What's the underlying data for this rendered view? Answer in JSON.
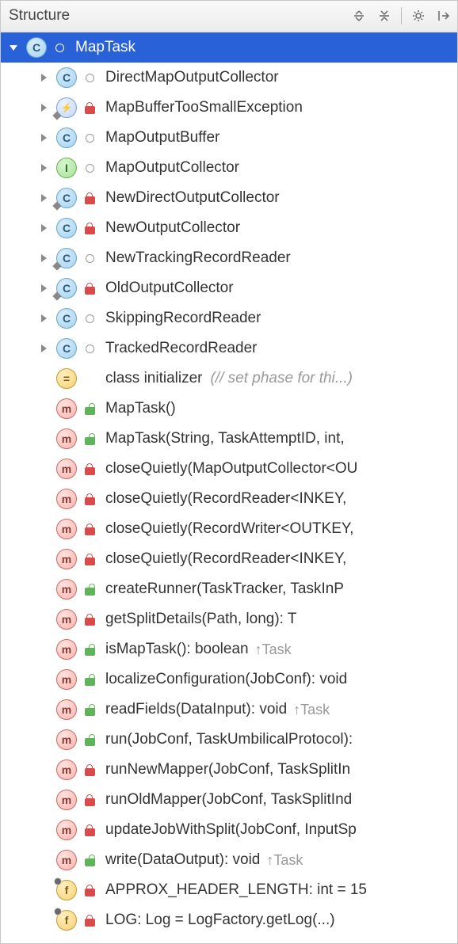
{
  "panel": {
    "title": "Structure"
  },
  "root": {
    "name": "MapTask",
    "kind_letter": "C"
  },
  "children": [
    {
      "expand": true,
      "kind": "class",
      "letter": "C",
      "vis": "circle",
      "label": "DirectMapOutputCollector"
    },
    {
      "expand": true,
      "kind": "exception",
      "letter": "",
      "vis": "red",
      "label": "MapBufferTooSmallException",
      "diamond": true
    },
    {
      "expand": true,
      "kind": "class",
      "letter": "C",
      "vis": "circle",
      "label": "MapOutputBuffer"
    },
    {
      "expand": true,
      "kind": "interface",
      "letter": "I",
      "vis": "circle",
      "label": "MapOutputCollector"
    },
    {
      "expand": true,
      "kind": "class",
      "letter": "C",
      "vis": "red",
      "label": "NewDirectOutputCollector",
      "diamond": true
    },
    {
      "expand": true,
      "kind": "class",
      "letter": "C",
      "vis": "red",
      "label": "NewOutputCollector"
    },
    {
      "expand": true,
      "kind": "class",
      "letter": "C",
      "vis": "circle",
      "label": "NewTrackingRecordReader",
      "diamond": true
    },
    {
      "expand": true,
      "kind": "class",
      "letter": "C",
      "vis": "red",
      "label": "OldOutputCollector",
      "diamond": true
    },
    {
      "expand": true,
      "kind": "class",
      "letter": "C",
      "vis": "circle",
      "label": "SkippingRecordReader"
    },
    {
      "expand": true,
      "kind": "class",
      "letter": "C",
      "vis": "circle",
      "label": "TrackedRecordReader"
    },
    {
      "expand": false,
      "kind": "init",
      "letter": "=",
      "vis": "",
      "label": "class initializer",
      "annot": "(// set phase for thi...)"
    },
    {
      "expand": false,
      "kind": "method",
      "letter": "m",
      "vis": "green",
      "label": "MapTask()"
    },
    {
      "expand": false,
      "kind": "method",
      "letter": "m",
      "vis": "green",
      "label": "MapTask(String, TaskAttemptID, int,"
    },
    {
      "expand": false,
      "kind": "method",
      "letter": "m",
      "vis": "red",
      "label": "closeQuietly(MapOutputCollector<OU"
    },
    {
      "expand": false,
      "kind": "method",
      "letter": "m",
      "vis": "red",
      "label": "closeQuietly(RecordReader<INKEY,"
    },
    {
      "expand": false,
      "kind": "method",
      "letter": "m",
      "vis": "red",
      "label": "closeQuietly(RecordWriter<OUTKEY,"
    },
    {
      "expand": false,
      "kind": "method",
      "letter": "m",
      "vis": "red",
      "label": "closeQuietly(RecordReader<INKEY,"
    },
    {
      "expand": false,
      "kind": "method",
      "letter": "m",
      "vis": "green",
      "label": "createRunner(TaskTracker, TaskInP"
    },
    {
      "expand": false,
      "kind": "method",
      "letter": "m",
      "vis": "red",
      "label": "getSplitDetails(Path, long): T"
    },
    {
      "expand": false,
      "kind": "method",
      "letter": "m",
      "vis": "green",
      "label": "isMapTask(): boolean",
      "inherit": "↑Task"
    },
    {
      "expand": false,
      "kind": "method",
      "letter": "m",
      "vis": "green",
      "label": "localizeConfiguration(JobConf): void"
    },
    {
      "expand": false,
      "kind": "method",
      "letter": "m",
      "vis": "green",
      "label": "readFields(DataInput): void",
      "inherit": "↑Task"
    },
    {
      "expand": false,
      "kind": "method",
      "letter": "m",
      "vis": "green",
      "label": "run(JobConf, TaskUmbilicalProtocol):"
    },
    {
      "expand": false,
      "kind": "method",
      "letter": "m",
      "vis": "red",
      "label": "runNewMapper(JobConf, TaskSplitIn"
    },
    {
      "expand": false,
      "kind": "method",
      "letter": "m",
      "vis": "red",
      "label": "runOldMapper(JobConf, TaskSplitInd"
    },
    {
      "expand": false,
      "kind": "method",
      "letter": "m",
      "vis": "red",
      "label": "updateJobWithSplit(JobConf, InputSp"
    },
    {
      "expand": false,
      "kind": "method",
      "letter": "m",
      "vis": "green",
      "label": "write(DataOutput): void",
      "inherit": "↑Task"
    },
    {
      "expand": false,
      "kind": "field",
      "letter": "f",
      "vis": "red",
      "label": "APPROX_HEADER_LENGTH: int = 15"
    },
    {
      "expand": false,
      "kind": "field",
      "letter": "f",
      "vis": "red",
      "label": "LOG: Log = LogFactory.getLog(...)"
    }
  ]
}
